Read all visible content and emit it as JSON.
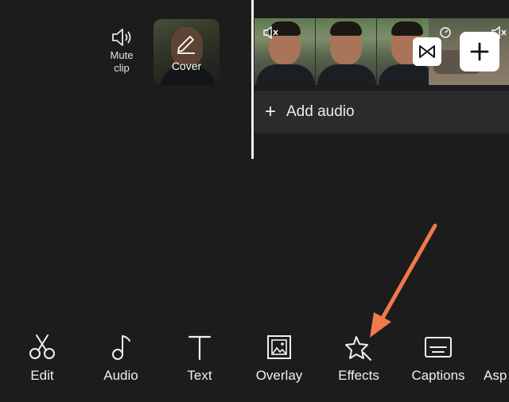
{
  "clip_actions": {
    "mute_clip": {
      "label": "Mute\nclip",
      "icon": "speaker-icon"
    },
    "cover": {
      "label": "Cover",
      "icon": "pencil-icon"
    }
  },
  "timeline": {
    "add_audio_label": "Add audio",
    "add_clip_icon": "plus-icon",
    "transition_icon": "transition-icon"
  },
  "toolbar": [
    {
      "label": "Edit",
      "icon": "scissors-icon"
    },
    {
      "label": "Audio",
      "icon": "music-note-icon"
    },
    {
      "label": "Text",
      "icon": "text-icon"
    },
    {
      "label": "Overlay",
      "icon": "overlay-icon"
    },
    {
      "label": "Effects",
      "icon": "effects-star-icon"
    },
    {
      "label": "Captions",
      "icon": "captions-icon"
    },
    {
      "label": "Asp",
      "icon": "aspect-icon"
    }
  ],
  "colors": {
    "background": "#1c1c1c",
    "arrow": "#f07a4a",
    "panel": "#2b2b2b"
  }
}
